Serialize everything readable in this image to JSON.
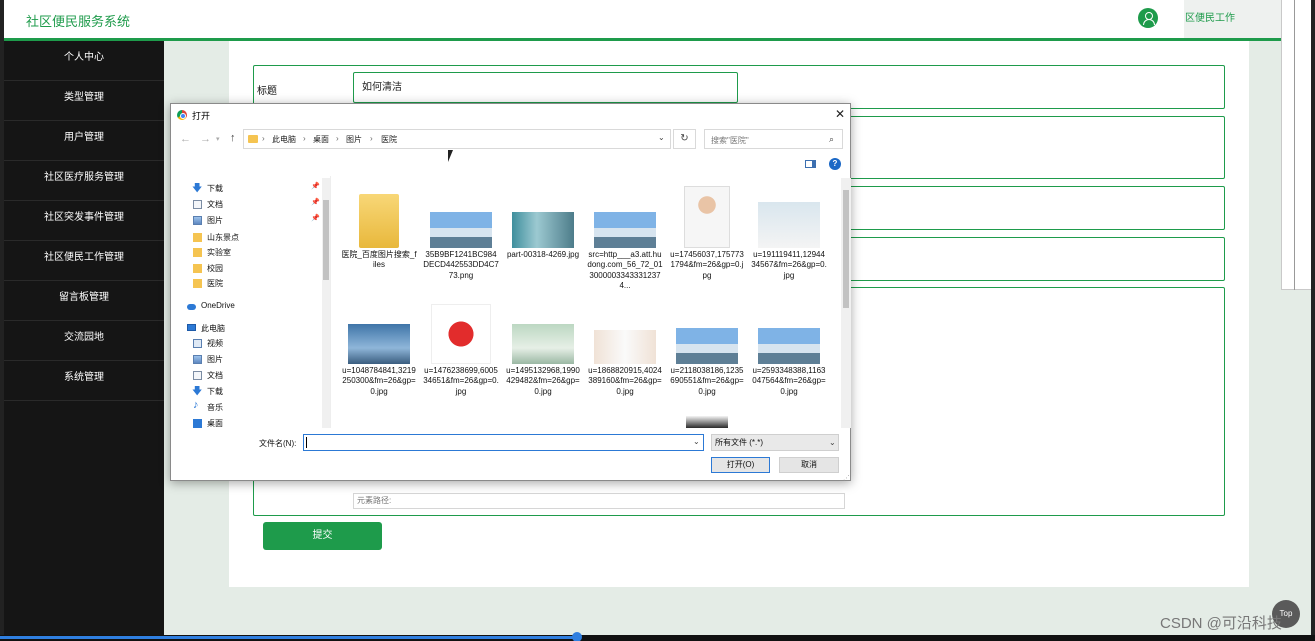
{
  "app": {
    "title": "社区便民服务系统",
    "top_tab": "区便民工作",
    "sidebar": [
      "个人中心",
      "类型管理",
      "用户管理",
      "社区医疗服务管理",
      "社区突发事件管理",
      "社区便民工作管理",
      "留言板管理",
      "交流园地",
      "系统管理"
    ],
    "form": {
      "title_label": "标题",
      "title_value": "如何清洁",
      "editor_footer": "元素路径:",
      "submit": "提交"
    },
    "top_button": "Top",
    "watermark": "CSDN @可沿科技"
  },
  "dialog": {
    "title": "打开",
    "breadcrumb": [
      "此电脑",
      "桌面",
      "图片",
      "医院"
    ],
    "search_placeholder": "搜索\"医院\"",
    "tree": [
      {
        "label": "下载",
        "icon": "download-icon",
        "pinned": true
      },
      {
        "label": "文档",
        "icon": "document-icon",
        "pinned": true
      },
      {
        "label": "图片",
        "icon": "pictures-icon",
        "pinned": true
      },
      {
        "label": "山东景点",
        "icon": "folder-icon",
        "pinned": false
      },
      {
        "label": "实验室",
        "icon": "folder-icon",
        "pinned": false
      },
      {
        "label": "校园",
        "icon": "folder-icon",
        "pinned": false
      },
      {
        "label": "医院",
        "icon": "folder-icon",
        "pinned": false
      },
      {
        "label": "OneDrive",
        "icon": "onedrive-icon",
        "pinned": false
      },
      {
        "label": "此电脑",
        "icon": "pc-icon",
        "pinned": false
      },
      {
        "label": "视频",
        "icon": "video-icon",
        "pinned": false
      },
      {
        "label": "图片",
        "icon": "pictures-icon",
        "pinned": false
      },
      {
        "label": "文档",
        "icon": "document-icon",
        "pinned": false
      },
      {
        "label": "下载",
        "icon": "download-icon",
        "pinned": false
      },
      {
        "label": "音乐",
        "icon": "music-icon",
        "pinned": false
      },
      {
        "label": "桌面",
        "icon": "desktop-icon",
        "pinned": false
      }
    ],
    "files": [
      {
        "name": "医院_百度图片搜索_files",
        "kind": "folder"
      },
      {
        "name": "35B9BF1241BC984DECD442553DD4C773.png",
        "kind": "building"
      },
      {
        "name": "part-00318-4269.jpg",
        "kind": "surgery"
      },
      {
        "name": "src=http___a3.att.hudong.com_56_72_0130000033433312374...",
        "kind": "building"
      },
      {
        "name": "u=17456037,1757731794&fm=26&gp=0.jpg",
        "kind": "doctor"
      },
      {
        "name": "u=191119411,1294434567&fm=26&gp=0.jpg",
        "kind": "staff"
      },
      {
        "name": "u=1048784841,3219250300&fm=26&gp=0.jpg",
        "kind": "ward"
      },
      {
        "name": "u=1476238699,600534651&fm=26&gp=0.jpg",
        "kind": "redcross"
      },
      {
        "name": "u=1495132968,1990429482&fm=26&gp=0.jpg",
        "kind": "clinic"
      },
      {
        "name": "u=1868820915,4024389160&fm=26&gp=0.jpg",
        "kind": "nurses"
      },
      {
        "name": "u=2118038186,1235690551&fm=26&gp=0.jpg",
        "kind": "building"
      },
      {
        "name": "u=2593348388,1163047564&fm=26&gp=0.jpg",
        "kind": "building"
      }
    ],
    "filename_label": "文件名(N):",
    "filename_value": "",
    "file_type": "所有文件 (*.*)",
    "open_button": "打开(O)",
    "cancel_button": "取消"
  }
}
